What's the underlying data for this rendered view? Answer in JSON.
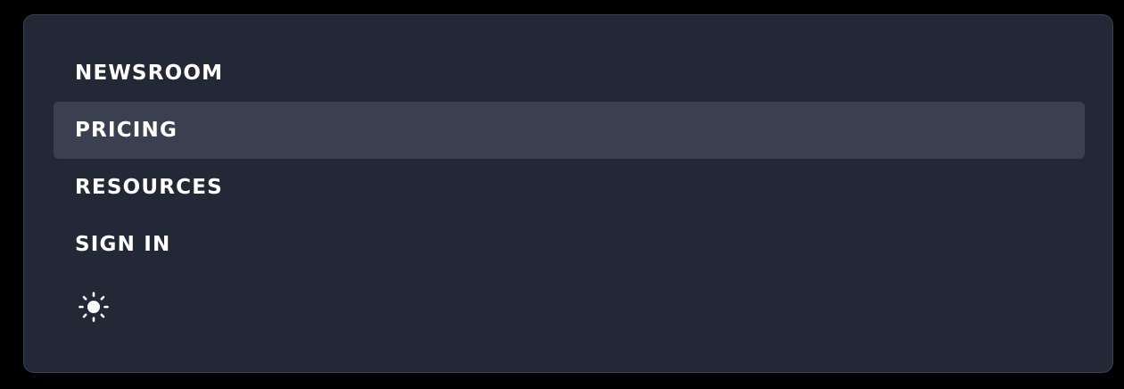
{
  "menu": {
    "items": [
      {
        "label": "NEWSROOM",
        "active": false
      },
      {
        "label": "PRICING",
        "active": true
      },
      {
        "label": "RESOURCES",
        "active": false
      },
      {
        "label": "SIGN IN",
        "active": false
      }
    ],
    "theme_toggle_icon": "sun-icon"
  },
  "colors": {
    "panel_background": "#222836",
    "active_item_background": "#3b4050",
    "text": "#ffffff"
  }
}
